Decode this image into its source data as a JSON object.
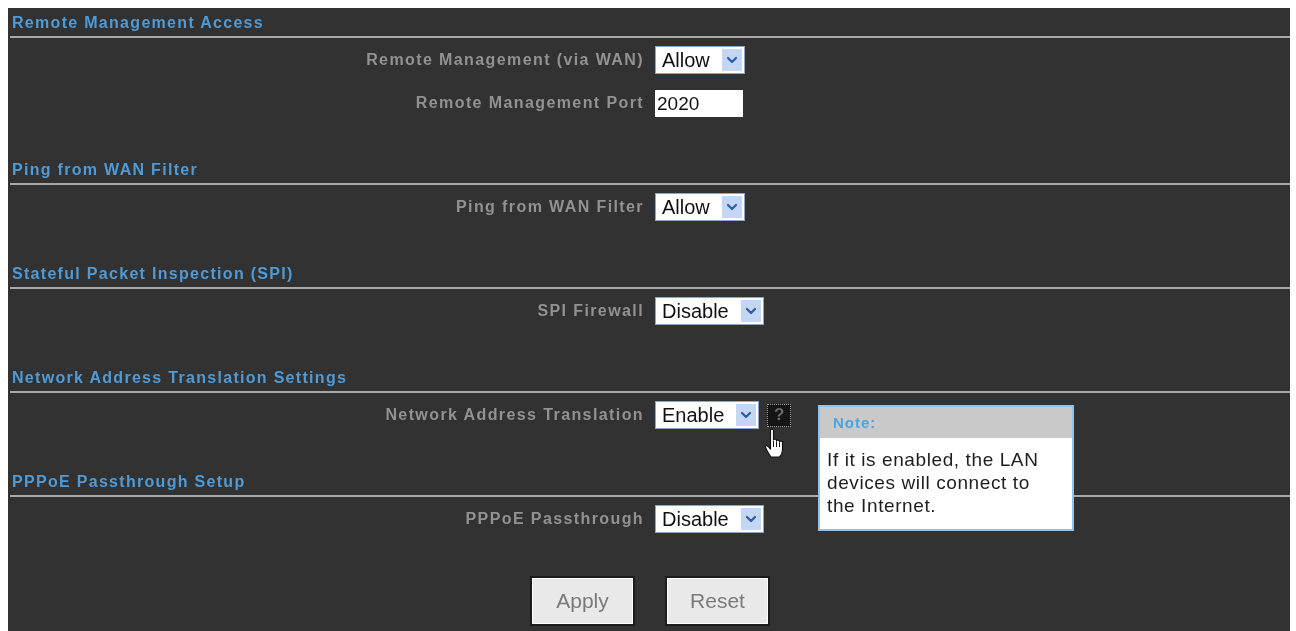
{
  "sections": [
    {
      "title": "Remote Management Access",
      "fields": [
        {
          "kind": "select",
          "label": "Remote Management (via WAN)",
          "value": "Allow"
        },
        {
          "kind": "text",
          "label": "Remote Management Port",
          "value": "2020"
        }
      ]
    },
    {
      "title": "Ping from WAN Filter",
      "fields": [
        {
          "kind": "select",
          "label": "Ping from WAN Filter",
          "value": "Allow"
        }
      ]
    },
    {
      "title": "Stateful Packet Inspection (SPI)",
      "fields": [
        {
          "kind": "select",
          "label": "SPI Firewall",
          "value": "Disable"
        }
      ]
    },
    {
      "title": "Network Address Translation Settings",
      "fields": [
        {
          "kind": "select",
          "label": "Network Address Translation",
          "value": "Enable",
          "help": "?",
          "note": {
            "title": "Note:",
            "text": "If it is enabled, the LAN devices will connect to the Internet."
          }
        }
      ]
    },
    {
      "title": "PPPoE Passthrough Setup",
      "fields": [
        {
          "kind": "select",
          "label": "PPPoE Passthrough",
          "value": "Disable"
        }
      ]
    }
  ],
  "buttons": [
    {
      "label": "Apply"
    },
    {
      "label": "Reset"
    }
  ]
}
